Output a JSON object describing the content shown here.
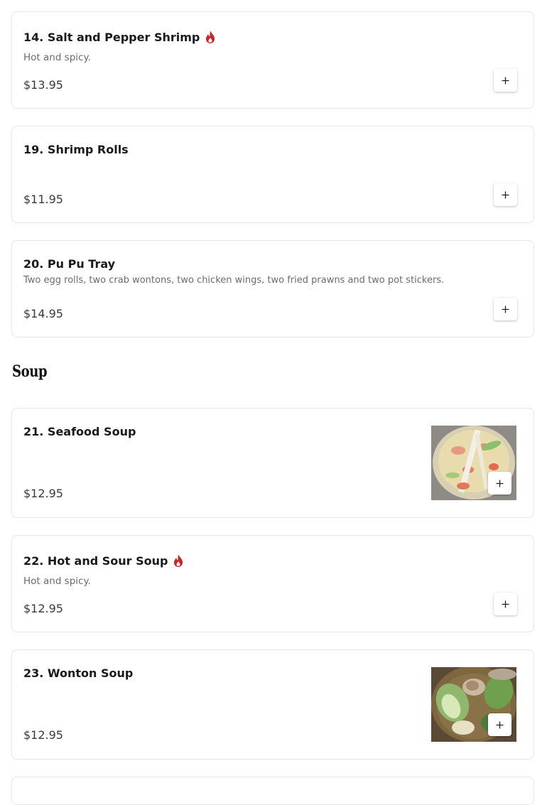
{
  "section": {
    "title": "Soup"
  },
  "items": [
    {
      "name": "14. Salt and Pepper Shrimp",
      "spicy": true,
      "description": "Hot and spicy.",
      "price": "$13.95",
      "has_image": false
    },
    {
      "name": "19. Shrimp Rolls",
      "spicy": false,
      "description": "",
      "price": "$11.95",
      "has_image": false
    },
    {
      "name": "20. Pu Pu Tray",
      "spicy": false,
      "description": "Two egg rolls, two crab wontons, two chicken wings, two fried prawns and two pot stickers.",
      "price": "$14.95",
      "has_image": false
    },
    {
      "name": "21. Seafood Soup",
      "spicy": false,
      "description": "",
      "price": "$12.95",
      "has_image": true
    },
    {
      "name": "22. Hot and Sour Soup",
      "spicy": true,
      "description": "Hot and spicy.",
      "price": "$12.95",
      "has_image": false
    },
    {
      "name": "23. Wonton Soup",
      "spicy": false,
      "description": "",
      "price": "$12.95",
      "has_image": true
    }
  ],
  "icons": {
    "spicy": "flame-icon",
    "add": "plus-icon"
  },
  "colors": {
    "spicy": "#c62828",
    "border": "#e6e6e6",
    "text": "#1a1a1a",
    "muted": "#6b6b6b"
  }
}
